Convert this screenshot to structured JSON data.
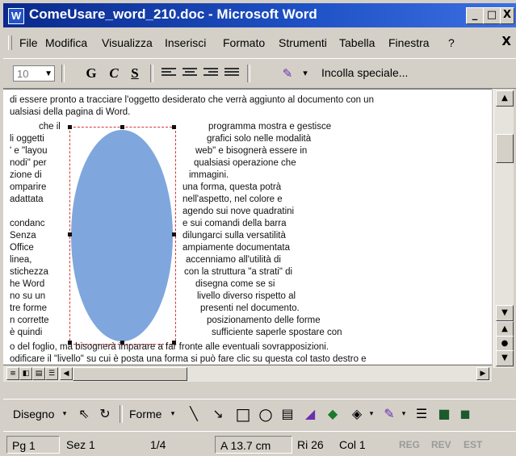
{
  "window": {
    "app_icon": "W",
    "title": "ComeUsare_word_210.doc - Microsoft Word",
    "buttons": {
      "minimize": "_",
      "maximize": "□",
      "close": "X"
    }
  },
  "menubar": {
    "items": [
      "File",
      "Modifica",
      "Visualizza",
      "Inserisci",
      "Formato",
      "Strumenti",
      "Tabella",
      "Finestra",
      "?"
    ],
    "close": "X"
  },
  "format_toolbar": {
    "font_size": "10",
    "bold": "G",
    "italic": "C",
    "underline": "S",
    "paste_special": "Incolla speciale..."
  },
  "document": {
    "lines": [
      "di essere pronto a tracciare l'oggetto desiderato che verrà aggiunto al documento con un",
      "ualsiasi della pagina di Word."
    ],
    "left_column": [
      "che  il",
      "li  oggetti",
      "' e \"layou",
      "nodi\"  per",
      "zione  di",
      "omparire",
      " adattata",
      "",
      "condanc",
      "  Senza",
      "  Office",
      "  linea,",
      "stichezza",
      "he  Word",
      "no su un",
      "tre  forme",
      "n  corrette",
      "è  quindi"
    ],
    "right_column": [
      "programma mostra e gestisce",
      "grafici  solo  nelle  modalità",
      "web\" e bisognerà essere in",
      "qualsiasi  operazione  che",
      "immagini.",
      "una  forma,  questa  potrà",
      "nell'aspetto,  nel colore  e",
      "agendo sui nove quadratini",
      "e sui comandi della barra",
      "dilungarci sulla versatilità",
      "ampiamente documentata",
      "accenniamo  all'utilità  di",
      "con la struttura \"a strati\" di",
      "disegna  come  se  si",
      "livello  diverso  rispetto  al",
      "presenti  nel  documento.",
      "posizionamento delle forme",
      "sufficiente saperle spostare con"
    ],
    "bottom_lines": [
      "o del foglio, ma bisognerà imparare a far fronte alle eventuali sovrapposizioni.",
      "odificare il \"livello\" su cui è posta una forma si può fare clic su questa col tasto destro e"
    ],
    "shape_color": "#7fa7dd",
    "selection_color": "#dd3333"
  },
  "draw_toolbar": {
    "draw_label": "Disegno",
    "shapes_label": "Forme",
    "icons": [
      "select-arrow-icon",
      "free-rotate-icon",
      "line-icon",
      "arrow-icon",
      "rectangle-icon",
      "oval-icon",
      "textbox-icon",
      "wordart-icon",
      "fill-color-icon",
      "line-color-icon",
      "line-style-icon",
      "shadow-icon",
      "3d-icon"
    ]
  },
  "statusbar": {
    "page": "Pg 1",
    "section": "Sez 1",
    "page_of": "1/4",
    "at": "A 13.7 cm",
    "row": "Ri 26",
    "col": "Col 1",
    "rec": "REG",
    "rev": "REV",
    "ext": "EST"
  }
}
